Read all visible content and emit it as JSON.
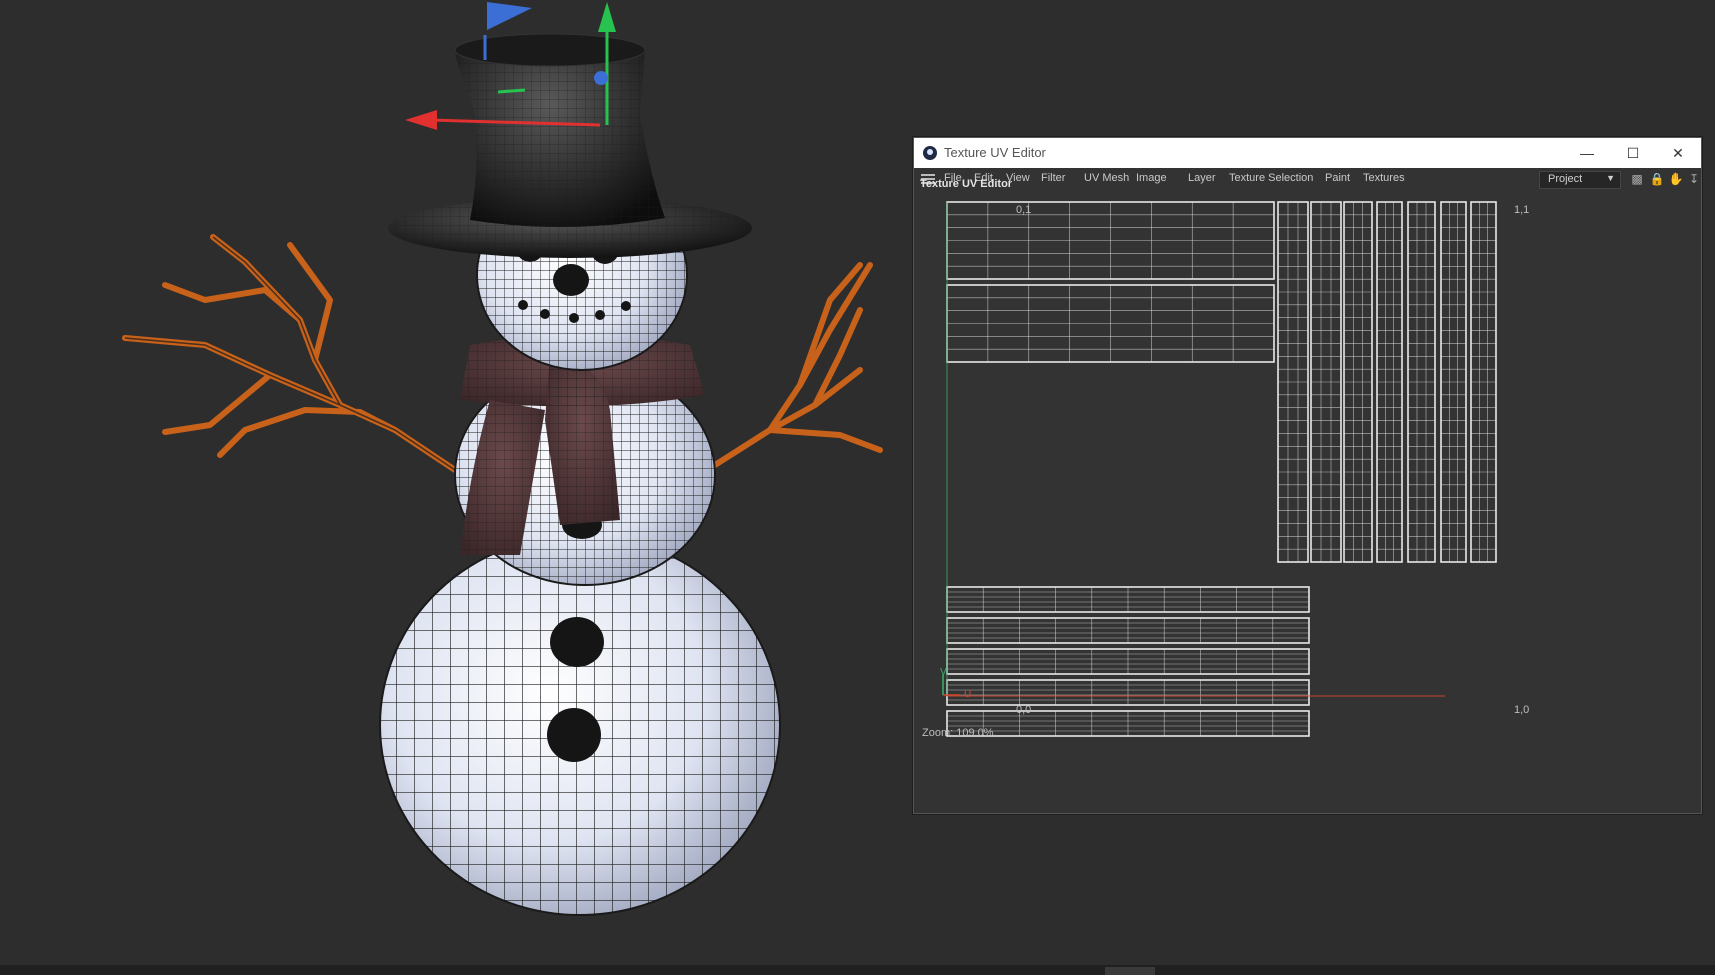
{
  "window": {
    "title": "Texture UV Editor",
    "panel_title": "Texture UV Editor",
    "zoom_text": "Zoom: 109.0%"
  },
  "menu": [
    "File",
    "Edit",
    "View",
    "Filter",
    "UV Mesh",
    "Image",
    "Layer",
    "Texture Selection",
    "Paint",
    "Textures"
  ],
  "toolbar": {
    "project_value": "Project"
  },
  "uv_labels": {
    "top_left": "0,1",
    "bottom_left": "0,0",
    "bottom_right": "1,0",
    "top_right": "1,1",
    "axis_v": "V",
    "axis_u": "U"
  },
  "icons": [
    "app-icon",
    "minimize-icon",
    "maximize-icon",
    "close-icon",
    "hamburger-icon",
    "chevron-down-icon",
    "histogram-icon",
    "lock-icon",
    "hand-icon",
    "pin-icon",
    "move-gizmo-icon"
  ],
  "colors": {
    "viewport_bg": "#2d2d2d",
    "panel_bg": "#333333",
    "uv_line": "#e8e8e8",
    "axis_u": "#d0492c",
    "axis_v": "#3fb06a",
    "branch": "#c8621a",
    "gizmo_x": "#e03030",
    "gizmo_y": "#27c24f",
    "gizmo_z": "#3b6fd6"
  }
}
